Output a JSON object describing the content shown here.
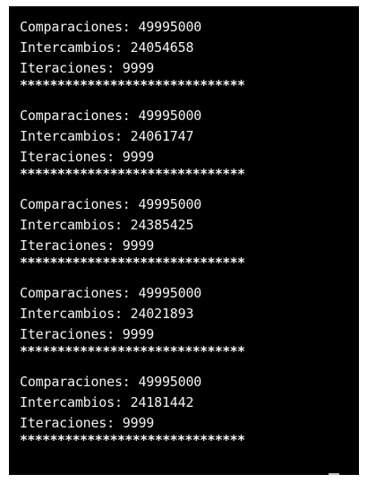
{
  "terminal": {
    "runs": [
      {
        "comparaciones": "Comparaciones: 49995000",
        "intercambios": "Intercambios: 24054658",
        "iteraciones": "Iteraciones: 9999",
        "separator": "******************************"
      },
      {
        "comparaciones": "Comparaciones: 49995000",
        "intercambios": "Intercambios: 24061747",
        "iteraciones": "Iteraciones: 9999",
        "separator": "******************************"
      },
      {
        "comparaciones": "Comparaciones: 49995000",
        "intercambios": "Intercambios: 24385425",
        "iteraciones": "Iteraciones: 9999",
        "separator": "******************************"
      },
      {
        "comparaciones": "Comparaciones: 49995000",
        "intercambios": "Intercambios: 24021893",
        "iteraciones": "Iteraciones: 9999",
        "separator": "******************************"
      },
      {
        "comparaciones": "Comparaciones: 49995000",
        "intercambios": "Intercambios: 24181442",
        "iteraciones": "Iteraciones: 9999",
        "separator": "******************************"
      }
    ],
    "background_color": "#000000",
    "text_color": "#f2f2f2"
  }
}
